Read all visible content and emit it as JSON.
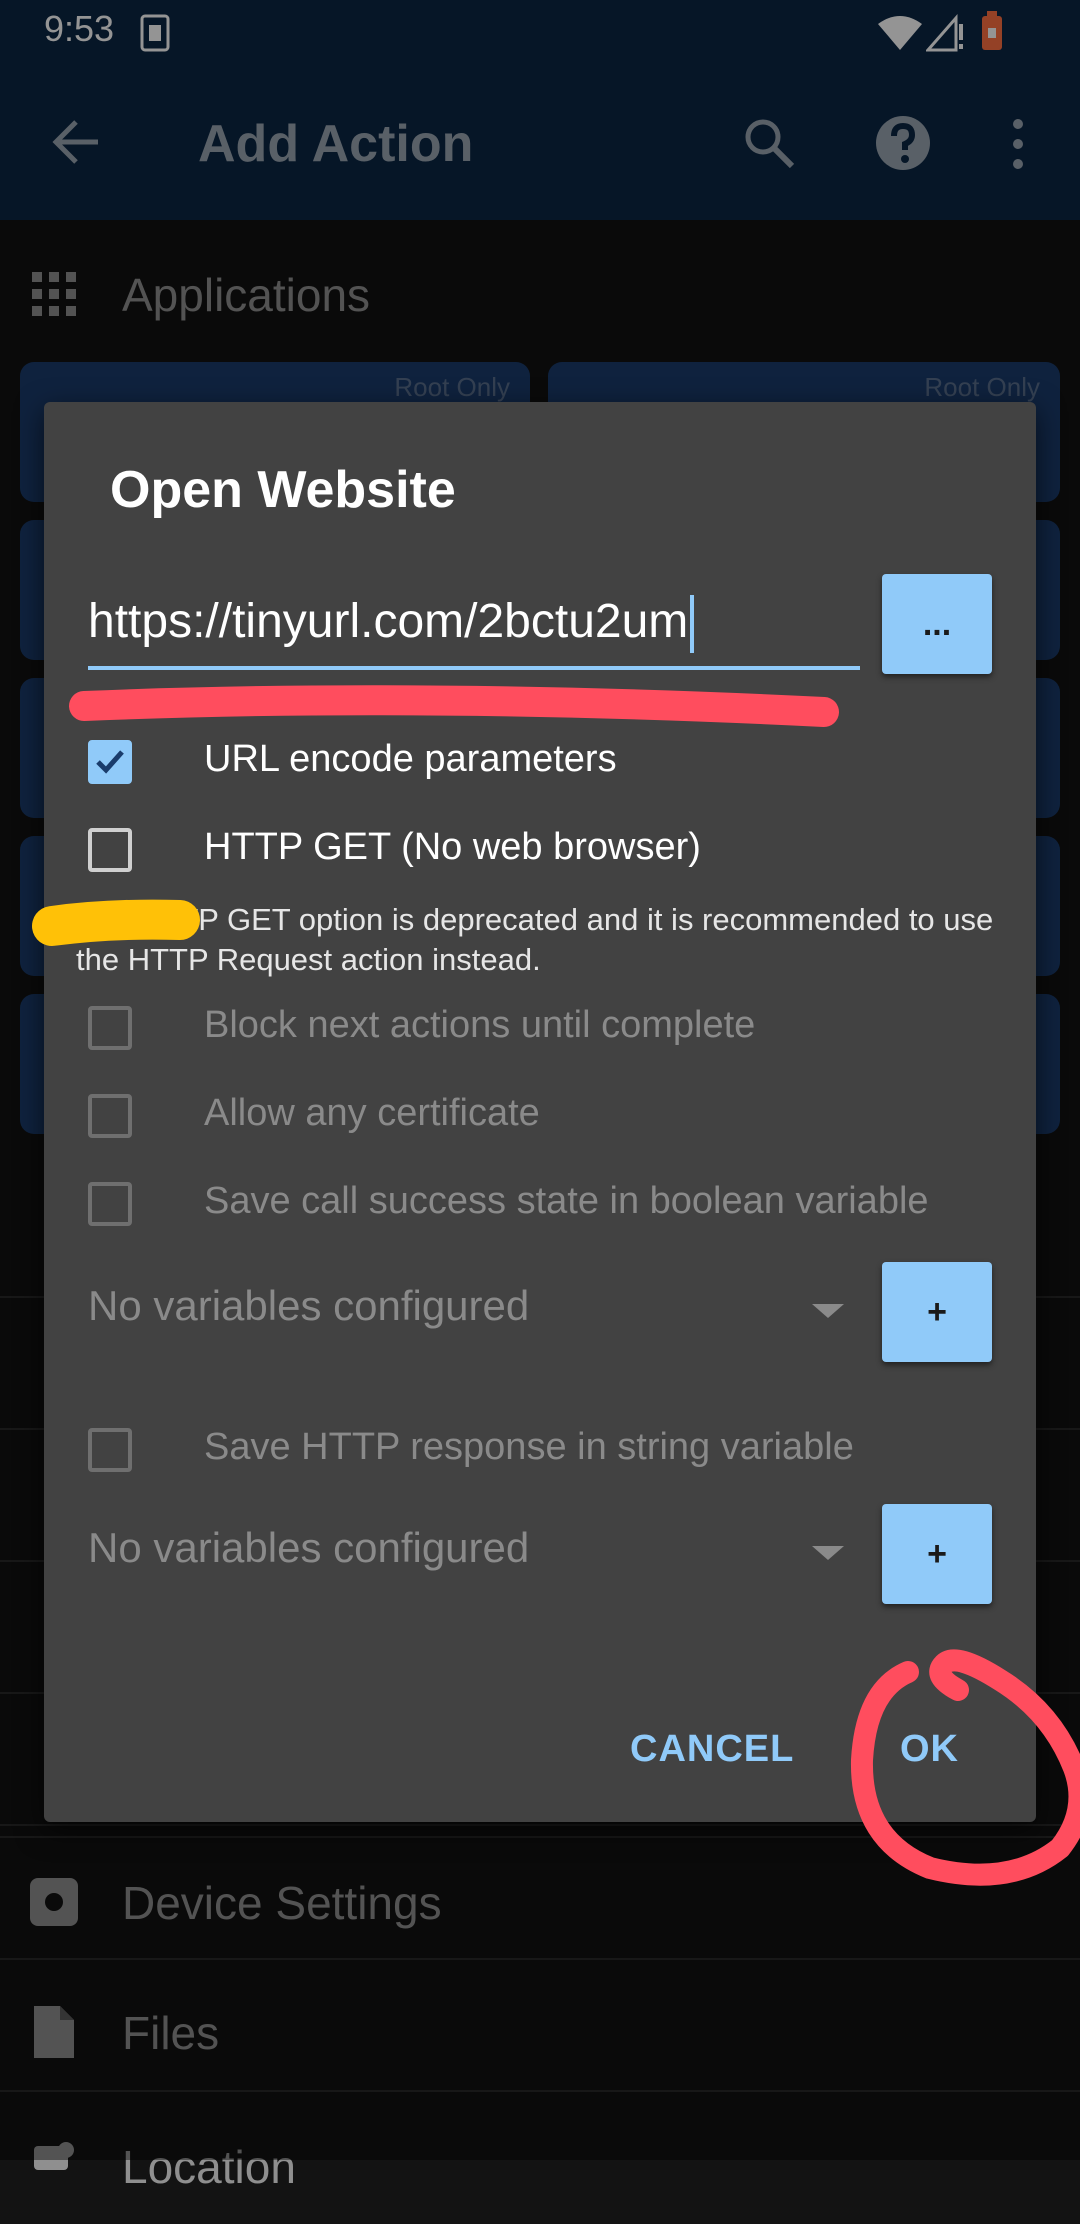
{
  "status_bar": {
    "time": "9:53"
  },
  "app_bar": {
    "title": "Add Action"
  },
  "background": {
    "category_applications": "Applications",
    "tile_tag": "Root Only",
    "category_device_settings": "Device Settings",
    "category_files": "Files",
    "category_location": "Location"
  },
  "dialog": {
    "title": "Open Website",
    "url_value": "https://tinyurl.com/2bctu2um",
    "url_picker_label": "...",
    "url_encode_label": "URL encode parameters",
    "url_encode_checked": true,
    "http_get_label": "HTTP GET (No web browser)",
    "http_get_checked": false,
    "deprecation_note": "The HTTP GET option is deprecated and it is recommended to use the HTTP Request action instead.",
    "block_label": "Block next actions until complete",
    "certificate_label": "Allow any certificate",
    "save_state_label": "Save call success state in boolean variable",
    "bool_select": "No variables configured",
    "add_label": "+",
    "save_response_label": "Save HTTP response in string variable",
    "string_select": "No variables configured",
    "cancel_label": "CANCEL",
    "ok_label": "OK"
  },
  "colors": {
    "accent": "#90caf9",
    "app_bar": "#0b2644",
    "dialog_bg": "#424242",
    "annotation_red": "#ff4d5e",
    "annotation_yellow": "#ffc107"
  }
}
